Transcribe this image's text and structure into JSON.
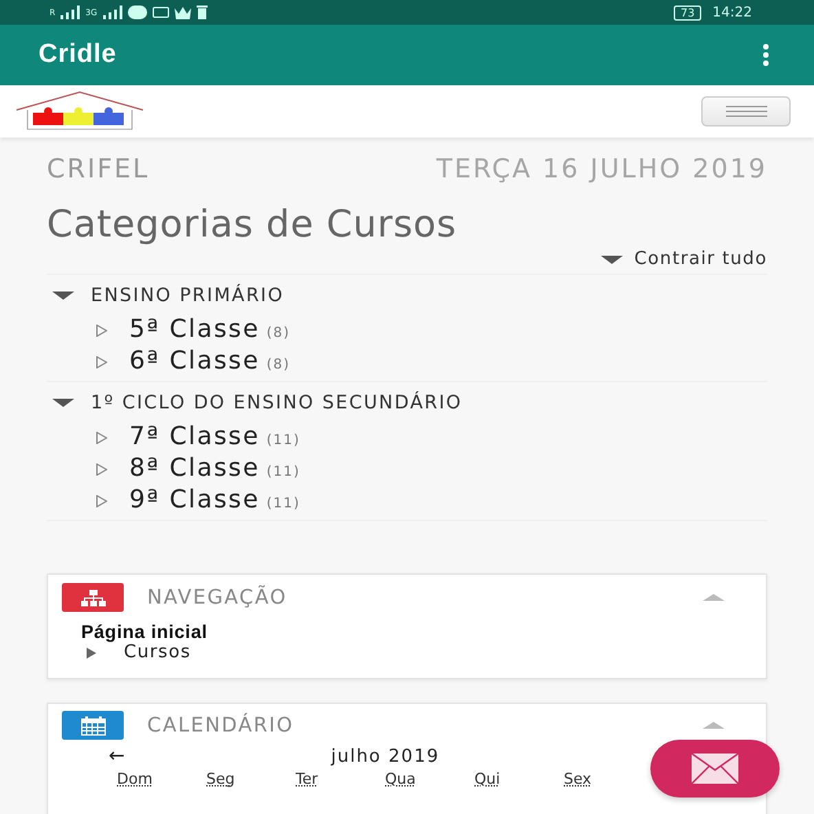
{
  "status_bar": {
    "signal_1": "R",
    "signal_2": "3G",
    "battery": "73",
    "time": "14:22"
  },
  "app_bar": {
    "title": "Cridle"
  },
  "page_header": {
    "site_name": "CRIFEL",
    "date": "TERÇA 16 JULHO 2019"
  },
  "page_title": "Categorias de Cursos",
  "collapse_all": {
    "label": "Contrair tudo"
  },
  "categories": [
    {
      "name": "ENSINO PRIMÁRIO",
      "expanded": true,
      "children": [
        {
          "name": "5ª Classe",
          "count": "(8)"
        },
        {
          "name": "6ª Classe",
          "count": "(8)"
        }
      ]
    },
    {
      "name": "1º CICLO DO ENSINO SECUNDÁRIO",
      "expanded": true,
      "children": [
        {
          "name": "7ª Classe",
          "count": "(11)"
        },
        {
          "name": "8ª Classe",
          "count": "(11)"
        },
        {
          "name": "9ª Classe",
          "count": "(11)"
        }
      ]
    }
  ],
  "navigation_block": {
    "title": "NAVEGAÇÃO",
    "home": "Página inicial",
    "items": [
      {
        "label": "Cursos"
      }
    ]
  },
  "calendar_block": {
    "title": "CALENDÁRIO",
    "prev": "←",
    "month": "julho 2019",
    "weekdays": [
      "Dom",
      "Seg",
      "Ter",
      "Qua",
      "Qui",
      "Sex"
    ]
  }
}
